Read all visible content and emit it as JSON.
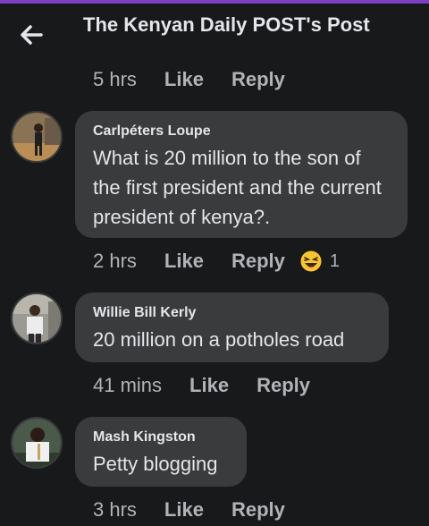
{
  "header": {
    "back_icon": "arrow-left-icon",
    "title": "The Kenyan Daily POST's Post",
    "time": "5 hrs",
    "like_label": "Like",
    "reply_label": "Reply"
  },
  "comments": [
    {
      "author": "Carlpéters Loupe",
      "text": "What is 20 million to the son of the first president and the current president of kenya?.",
      "time": "2 hrs",
      "like_label": "Like",
      "reply_label": "Reply",
      "reaction_icon": "laughing-emoji-icon",
      "reaction_count": "1"
    },
    {
      "author": "Willie Bill Kerly",
      "text": "20 million on a potholes road",
      "time": "41 mins",
      "like_label": "Like",
      "reply_label": "Reply"
    },
    {
      "author": "Mash Kingston",
      "text": "Petty blogging",
      "time": "3 hrs",
      "like_label": "Like",
      "reply_label": "Reply"
    }
  ],
  "colors": {
    "background": "#18191a",
    "bubble": "#3a3b3c",
    "primary_text": "#e4e6eb",
    "secondary_text": "#b0b3b8",
    "accent_bar": "#7d3fc4",
    "emoji": "#f7c533"
  }
}
